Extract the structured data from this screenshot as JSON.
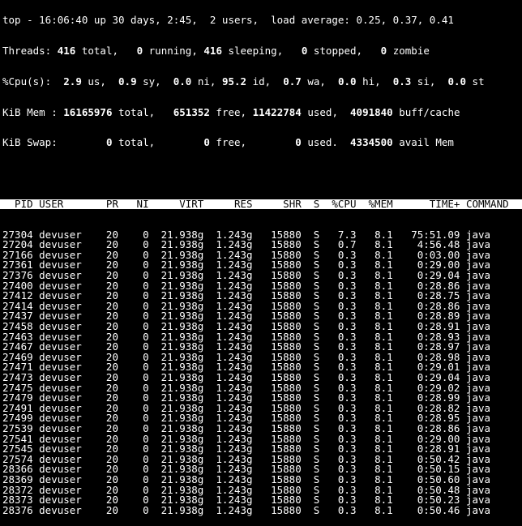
{
  "summary": {
    "top_line": "top - 16:06:40 up 30 days, 2:45,  2 users,  load average: 0.25, 0.37, 0.41",
    "tasks": {
      "label": "Threads:",
      "total": "416",
      "running": "0",
      "sleeping": "416",
      "stopped": "0",
      "zombie": "0"
    },
    "cpu": {
      "label": "%Cpu(s):",
      "us": "2.9",
      "sy": "0.9",
      "ni": "0.0",
      "id": "95.2",
      "wa": "0.7",
      "hi": "0.0",
      "si": "0.3",
      "st": "0.0"
    },
    "mem": {
      "label": "KiB Mem :",
      "total": "16165976",
      "free": "651352",
      "used": "11422784",
      "buff_cache": "4091840"
    },
    "swap": {
      "label": "KiB Swap:",
      "total": "0",
      "free": "0",
      "used": "0",
      "avail": "4334500"
    }
  },
  "columns": [
    "PID",
    "USER",
    "PR",
    "NI",
    "VIRT",
    "RES",
    "SHR",
    "S",
    "%CPU",
    "%MEM",
    "TIME+",
    "COMMAND"
  ],
  "rows": [
    [
      "27304",
      "devuser",
      "20",
      "0",
      "21.938g",
      "1.243g",
      "15880",
      "S",
      "7.3",
      "8.1",
      "75:51.09",
      "java"
    ],
    [
      "27204",
      "devuser",
      "20",
      "0",
      "21.938g",
      "1.243g",
      "15880",
      "S",
      "0.7",
      "8.1",
      "4:56.48",
      "java"
    ],
    [
      "27166",
      "devuser",
      "20",
      "0",
      "21.938g",
      "1.243g",
      "15880",
      "S",
      "0.3",
      "8.1",
      "0:03.00",
      "java"
    ],
    [
      "27361",
      "devuser",
      "20",
      "0",
      "21.938g",
      "1.243g",
      "15880",
      "S",
      "0.3",
      "8.1",
      "0:29.00",
      "java"
    ],
    [
      "27376",
      "devuser",
      "20",
      "0",
      "21.938g",
      "1.243g",
      "15880",
      "S",
      "0.3",
      "8.1",
      "0:29.04",
      "java"
    ],
    [
      "27400",
      "devuser",
      "20",
      "0",
      "21.938g",
      "1.243g",
      "15880",
      "S",
      "0.3",
      "8.1",
      "0:28.86",
      "java"
    ],
    [
      "27412",
      "devuser",
      "20",
      "0",
      "21.938g",
      "1.243g",
      "15880",
      "S",
      "0.3",
      "8.1",
      "0:28.75",
      "java"
    ],
    [
      "27414",
      "devuser",
      "20",
      "0",
      "21.938g",
      "1.243g",
      "15880",
      "S",
      "0.3",
      "8.1",
      "0:28.86",
      "java"
    ],
    [
      "27437",
      "devuser",
      "20",
      "0",
      "21.938g",
      "1.243g",
      "15880",
      "S",
      "0.3",
      "8.1",
      "0:28.89",
      "java"
    ],
    [
      "27458",
      "devuser",
      "20",
      "0",
      "21.938g",
      "1.243g",
      "15880",
      "S",
      "0.3",
      "8.1",
      "0:28.91",
      "java"
    ],
    [
      "27463",
      "devuser",
      "20",
      "0",
      "21.938g",
      "1.243g",
      "15880",
      "S",
      "0.3",
      "8.1",
      "0:28.93",
      "java"
    ],
    [
      "27467",
      "devuser",
      "20",
      "0",
      "21.938g",
      "1.243g",
      "15880",
      "S",
      "0.3",
      "8.1",
      "0:28.97",
      "java"
    ],
    [
      "27469",
      "devuser",
      "20",
      "0",
      "21.938g",
      "1.243g",
      "15880",
      "S",
      "0.3",
      "8.1",
      "0:28.98",
      "java"
    ],
    [
      "27471",
      "devuser",
      "20",
      "0",
      "21.938g",
      "1.243g",
      "15880",
      "S",
      "0.3",
      "8.1",
      "0:29.01",
      "java"
    ],
    [
      "27473",
      "devuser",
      "20",
      "0",
      "21.938g",
      "1.243g",
      "15880",
      "S",
      "0.3",
      "8.1",
      "0:29.04",
      "java"
    ],
    [
      "27475",
      "devuser",
      "20",
      "0",
      "21.938g",
      "1.243g",
      "15880",
      "S",
      "0.3",
      "8.1",
      "0:29.02",
      "java"
    ],
    [
      "27479",
      "devuser",
      "20",
      "0",
      "21.938g",
      "1.243g",
      "15880",
      "S",
      "0.3",
      "8.1",
      "0:28.99",
      "java"
    ],
    [
      "27491",
      "devuser",
      "20",
      "0",
      "21.938g",
      "1.243g",
      "15880",
      "S",
      "0.3",
      "8.1",
      "0:28.82",
      "java"
    ],
    [
      "27499",
      "devuser",
      "20",
      "0",
      "21.938g",
      "1.243g",
      "15880",
      "S",
      "0.3",
      "8.1",
      "0:28.95",
      "java"
    ],
    [
      "27539",
      "devuser",
      "20",
      "0",
      "21.938g",
      "1.243g",
      "15880",
      "S",
      "0.3",
      "8.1",
      "0:28.86",
      "java"
    ],
    [
      "27541",
      "devuser",
      "20",
      "0",
      "21.938g",
      "1.243g",
      "15880",
      "S",
      "0.3",
      "8.1",
      "0:29.00",
      "java"
    ],
    [
      "27545",
      "devuser",
      "20",
      "0",
      "21.938g",
      "1.243g",
      "15880",
      "S",
      "0.3",
      "8.1",
      "0:28.91",
      "java"
    ],
    [
      "27574",
      "devuser",
      "20",
      "0",
      "21.938g",
      "1.243g",
      "15880",
      "S",
      "0.3",
      "8.1",
      "0:50.42",
      "java"
    ],
    [
      "28366",
      "devuser",
      "20",
      "0",
      "21.938g",
      "1.243g",
      "15880",
      "S",
      "0.3",
      "8.1",
      "0:50.15",
      "java"
    ],
    [
      "28369",
      "devuser",
      "20",
      "0",
      "21.938g",
      "1.243g",
      "15880",
      "S",
      "0.3",
      "8.1",
      "0:50.60",
      "java"
    ],
    [
      "28372",
      "devuser",
      "20",
      "0",
      "21.938g",
      "1.243g",
      "15880",
      "S",
      "0.3",
      "8.1",
      "0:50.48",
      "java"
    ],
    [
      "28373",
      "devuser",
      "20",
      "0",
      "21.938g",
      "1.243g",
      "15880",
      "S",
      "0.3",
      "8.1",
      "0:50.23",
      "java"
    ],
    [
      "28376",
      "devuser",
      "20",
      "0",
      "21.938g",
      "1.243g",
      "15880",
      "S",
      "0.3",
      "8.1",
      "0:50.46",
      "java"
    ]
  ]
}
